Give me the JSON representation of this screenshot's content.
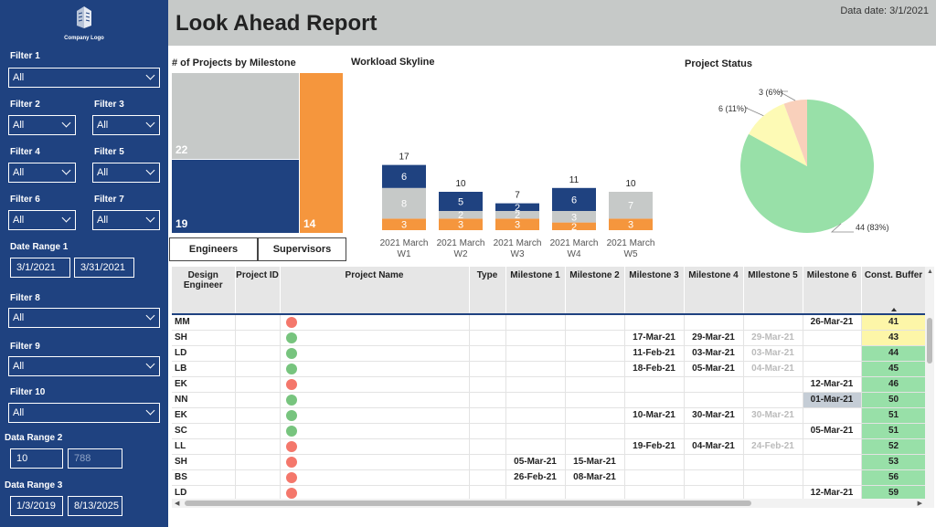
{
  "sidebar": {
    "logo_text": "Company Logo",
    "filters": [
      {
        "label": "Filter 1",
        "value": "All"
      },
      {
        "label": "Filter 2",
        "value": "All"
      },
      {
        "label": "Filter 3",
        "value": "All"
      },
      {
        "label": "Filter 4",
        "value": "All"
      },
      {
        "label": "Filter 5",
        "value": "All"
      },
      {
        "label": "Filter 6",
        "value": "All"
      },
      {
        "label": "Filter 7",
        "value": "All"
      },
      {
        "label": "Filter 8",
        "value": "All"
      },
      {
        "label": "Filter 9",
        "value": "All"
      },
      {
        "label": "Filter 10",
        "value": "All"
      }
    ],
    "date_range_1": {
      "label": "Date Range 1",
      "start": "3/1/2021",
      "end": "3/31/2021"
    },
    "data_range_2": {
      "label": "Data Range 2",
      "start": "10",
      "end": "788"
    },
    "data_range_3": {
      "label": "Data Range 3",
      "start": "1/3/2019",
      "end": "8/13/2025"
    }
  },
  "header": {
    "title": "Look Ahead Report",
    "data_date": "Data date: 3/1/2021"
  },
  "treemap": {
    "title": "# of Projects by Milestone",
    "values": {
      "grey": "22",
      "blue": "19",
      "orange": "14"
    },
    "colors": {
      "grey": "#c6c9c8",
      "blue": "#1f4280",
      "orange": "#f5963d"
    }
  },
  "tabs": {
    "engineers": "Engineers",
    "supervisors": "Supervisors"
  },
  "chart_data": [
    {
      "type": "bar",
      "title": "Workload Skyline",
      "categories": [
        [
          "2021 March",
          "W1"
        ],
        [
          "2021 March",
          "W2"
        ],
        [
          "2021 March",
          "W3"
        ],
        [
          "2021 March",
          "W4"
        ],
        [
          "2021 March",
          "W5"
        ]
      ],
      "series": [
        {
          "color": "#f5963d",
          "values": [
            3,
            3,
            3,
            2,
            3
          ]
        },
        {
          "color": "#c6c9c8",
          "values": [
            8,
            2,
            2,
            3,
            7
          ]
        },
        {
          "color": "#1f4280",
          "values": [
            6,
            5,
            2,
            6,
            0
          ]
        }
      ],
      "totals": [
        17,
        10,
        7,
        11,
        10
      ]
    },
    {
      "type": "pie",
      "title": "Project Status",
      "slices": [
        {
          "value": 44,
          "label": "44 (83%)",
          "color": "#98e0a8"
        },
        {
          "value": 6,
          "label": "6 (11%)",
          "color": "#fdfab5"
        },
        {
          "value": 3,
          "label": "3 (6%)",
          "color": "#f9d0bb"
        }
      ]
    }
  ],
  "table": {
    "headers": [
      "Design Engineer",
      "Project ID",
      "Project Name",
      "Type",
      "Milestone 1",
      "Milestone 2",
      "Milestone 3",
      "Milestone 4",
      "MIlestone 5",
      "Milestone 6",
      "Const. Buffer"
    ],
    "status_colors": {
      "red": "#f4776b",
      "green": "#77c47e"
    },
    "buffer_colors": {
      "yellow": "#fdf6a8",
      "green": "#98e0a8"
    },
    "rows": [
      {
        "eng": "MM",
        "status": "red",
        "m1": "",
        "m2": "",
        "m3": "",
        "m4": "",
        "m5": "",
        "m6": "26-Mar-21",
        "buf": "41",
        "bufc": "yellow"
      },
      {
        "eng": "SH",
        "status": "green",
        "m1": "",
        "m2": "",
        "m3": "17-Mar-21",
        "m4": "29-Mar-21",
        "m5": "29-Mar-21",
        "m6": "",
        "buf": "43",
        "bufc": "yellow"
      },
      {
        "eng": "LD",
        "status": "green",
        "m1": "",
        "m2": "",
        "m3": "11-Feb-21",
        "m4": "03-Mar-21",
        "m5": "03-Mar-21",
        "m6": "",
        "buf": "44",
        "bufc": "green"
      },
      {
        "eng": "LB",
        "status": "green",
        "m1": "",
        "m2": "",
        "m3": "18-Feb-21",
        "m4": "05-Mar-21",
        "m5": "04-Mar-21",
        "m6": "",
        "buf": "45",
        "bufc": "green"
      },
      {
        "eng": "EK",
        "status": "red",
        "m1": "",
        "m2": "",
        "m3": "",
        "m4": "",
        "m5": "",
        "m6": "12-Mar-21",
        "buf": "46",
        "bufc": "green"
      },
      {
        "eng": "NN",
        "status": "green",
        "m1": "",
        "m2": "",
        "m3": "",
        "m4": "",
        "m5": "",
        "m6": "01-Mar-21",
        "buf": "50",
        "bufc": "green",
        "hl": true
      },
      {
        "eng": "EK",
        "status": "green",
        "m1": "",
        "m2": "",
        "m3": "10-Mar-21",
        "m4": "30-Mar-21",
        "m5": "30-Mar-21",
        "m6": "",
        "buf": "51",
        "bufc": "green"
      },
      {
        "eng": "SC",
        "status": "green",
        "m1": "",
        "m2": "",
        "m3": "",
        "m4": "",
        "m5": "",
        "m6": "05-Mar-21",
        "buf": "51",
        "bufc": "green"
      },
      {
        "eng": "LL",
        "status": "red",
        "m1": "",
        "m2": "",
        "m3": "19-Feb-21",
        "m4": "04-Mar-21",
        "m5": "24-Feb-21",
        "m6": "",
        "buf": "52",
        "bufc": "green"
      },
      {
        "eng": "SH",
        "status": "red",
        "m1": "05-Mar-21",
        "m2": "15-Mar-21",
        "m3": "",
        "m4": "",
        "m5": "",
        "m6": "",
        "buf": "53",
        "bufc": "green"
      },
      {
        "eng": "BS",
        "status": "red",
        "m1": "26-Feb-21",
        "m2": "08-Mar-21",
        "m3": "",
        "m4": "",
        "m5": "",
        "m6": "",
        "buf": "56",
        "bufc": "green"
      },
      {
        "eng": "LD",
        "status": "red",
        "m1": "",
        "m2": "",
        "m3": "",
        "m4": "",
        "m5": "",
        "m6": "12-Mar-21",
        "buf": "59",
        "bufc": "green"
      }
    ]
  }
}
